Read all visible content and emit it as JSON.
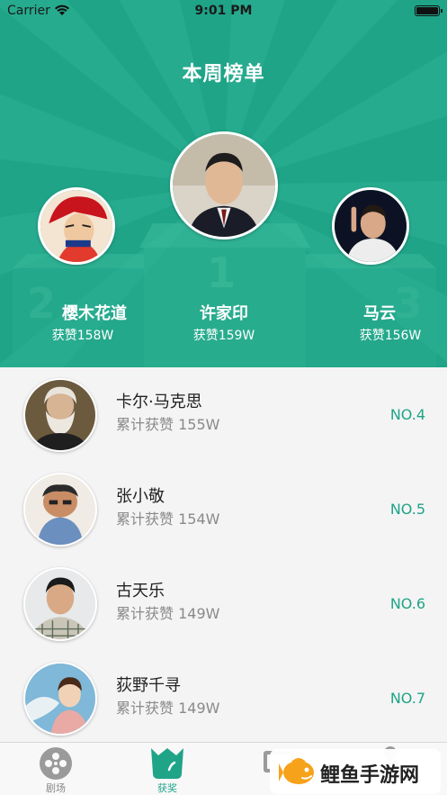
{
  "status_bar": {
    "carrier": "Carrier",
    "time": "9:01 PM"
  },
  "page": {
    "title": "本周榜单"
  },
  "colors": {
    "primary": "#1fa488",
    "rank": "#1fa488"
  },
  "podium": {
    "numbers": {
      "first": "1",
      "second": "2",
      "third": "3"
    },
    "entries": [
      {
        "position": 2,
        "name": "樱木花道",
        "likes": "获赞158W"
      },
      {
        "position": 1,
        "name": "许家印",
        "likes": "获赞159W"
      },
      {
        "position": 3,
        "name": "马云",
        "likes": "获赞156W"
      }
    ]
  },
  "list": {
    "items": [
      {
        "name": "卡尔·马克思",
        "likes_label": "累计获赞",
        "likes": "155W",
        "rank": "NO.4"
      },
      {
        "name": "张小敬",
        "likes_label": "累计获赞",
        "likes": "154W",
        "rank": "NO.5"
      },
      {
        "name": "古天乐",
        "likes_label": "累计获赞",
        "likes": "149W",
        "rank": "NO.6"
      },
      {
        "name": "荻野千寻",
        "likes_label": "累计获赞",
        "likes": "149W",
        "rank": "NO.7"
      }
    ]
  },
  "tabbar": {
    "tabs": [
      {
        "label": "剧场",
        "icon": "film-reel-icon",
        "active": false
      },
      {
        "label": "获奖",
        "icon": "crown-icon",
        "active": true
      },
      {
        "label": "",
        "icon": "tv-icon",
        "active": false
      },
      {
        "label": "",
        "icon": "profile-icon",
        "active": false
      }
    ]
  },
  "watermark": {
    "text": "鲤鱼手游网",
    "icon": "carp-logo-icon"
  }
}
